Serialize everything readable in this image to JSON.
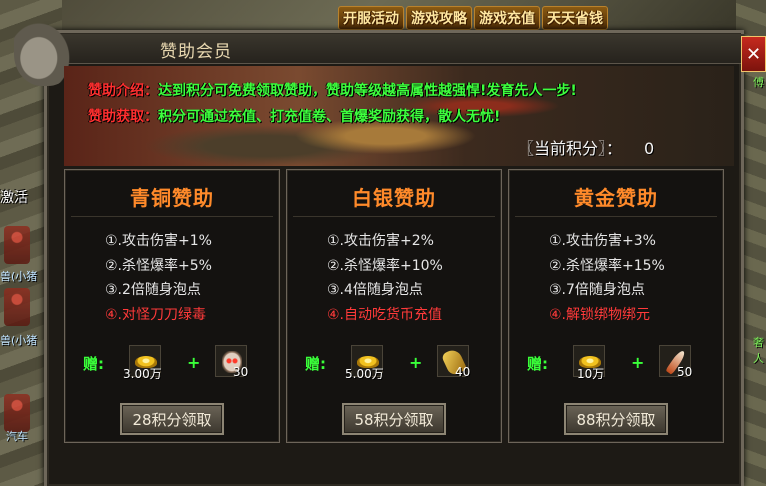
{
  "top_menu": [
    "开服活动",
    "游戏攻略",
    "游戏充值",
    "天天省钱"
  ],
  "world": {
    "left_label": "激活",
    "npc_labels": [
      "兽(小猪",
      "兽(小猪",
      "汽车"
    ]
  },
  "panel": {
    "title": "赞助会员",
    "close_label": "✕",
    "intro_label": "赞助介绍：",
    "intro_text": "达到积分可免费领取赞助，赞助等级越高属性越强悍!发育先人一步!",
    "acquire_label": "赞助获取：",
    "acquire_text": "积分可通过充值、打充值卷、首爆奖励获得，散人无忧!",
    "points_label": "〖当前积分〗：",
    "points_value": "0"
  },
  "tiers": [
    {
      "title": "青铜赞助",
      "benefits": [
        "①.攻击伤害+1%",
        "②.杀怪爆率+5%",
        "③.2倍随身泡点",
        "④.对怪刀刀绿毒"
      ],
      "gift_label": "赠:",
      "gift1_icon": "gold-ingot-icon",
      "gift1_count": "3.00万",
      "gift2_icon": "skull-icon",
      "gift2_count": "30",
      "button": "28积分领取"
    },
    {
      "title": "白银赞助",
      "benefits": [
        "①.攻击伤害+2%",
        "②.杀怪爆率+10%",
        "③.4倍随身泡点",
        "④.自动吃货币充值"
      ],
      "gift_label": "赠:",
      "gift1_icon": "gold-ingot-icon",
      "gift1_count": "5.00万",
      "gift2_icon": "glove-icon",
      "gift2_count": "40",
      "button": "58积分领取"
    },
    {
      "title": "黄金赞助",
      "benefits": [
        "①.攻击伤害+3%",
        "②.杀怪爆率+15%",
        "③.7倍随身泡点",
        "④.解锁绑物绑元"
      ],
      "gift_label": "赠:",
      "gift1_icon": "gold-ingot-icon",
      "gift1_count": "10万",
      "gift2_icon": "fang-icon",
      "gift2_count": "50",
      "button": "88积分领取"
    }
  ],
  "side_labels": [
    "傅",
    "奢",
    "人"
  ]
}
